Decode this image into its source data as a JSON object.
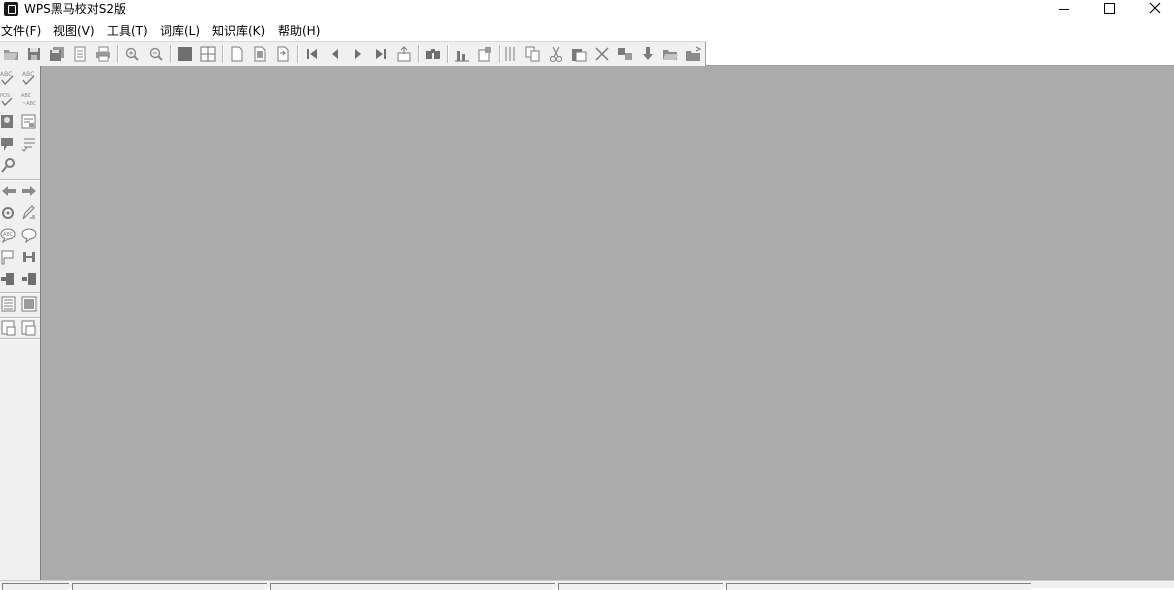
{
  "window": {
    "title": "WPS黑马校对S2版",
    "controls": [
      "minimize-icon",
      "maximize-icon",
      "close-icon"
    ]
  },
  "menu": {
    "items": [
      {
        "label": "文件(F)"
      },
      {
        "label": "视图(V)"
      },
      {
        "label": "工具(T)"
      },
      {
        "label": "词库(L)"
      },
      {
        "label": "知识库(K)"
      },
      {
        "label": "帮助(H)"
      }
    ]
  },
  "toolbar": {
    "buttons": [
      "open-folder-icon",
      "save-icon",
      "save-all-icon",
      "document-list-icon",
      "print-icon",
      "zoom-in-icon",
      "zoom-out-icon",
      "single-view-icon",
      "grid-view-icon",
      "page-icon",
      "page-duplicate-icon",
      "page-export-icon",
      "first-icon",
      "previous-icon",
      "next-icon",
      "last-icon",
      "jump-icon",
      "find-icon",
      "statistics-icon",
      "report-icon",
      "columns-icon",
      "copy-icon",
      "cut-icon",
      "paste-icon",
      "delete-icon",
      "replace-icon",
      "download-icon",
      "open-icon",
      "import-icon"
    ]
  },
  "left_toolbar": {
    "buttons": [
      "spell-check-icon",
      "abc-check-icon",
      "proofread-icon",
      "abc-compare-icon",
      "person-lookup-icon",
      "dictionary-icon",
      "comment-icon",
      "list-check-icon",
      "tool-icon",
      "back-arrow-icon",
      "forward-arrow-icon",
      "settings-icon",
      "pen-icon",
      "speech-bubble-icon",
      "speech-bubble-alt-icon",
      "flag-icon",
      "h-bar-icon",
      "plug-in-icon",
      "plug-out-icon",
      "page-list-icon",
      "image-icon",
      "export-left-icon",
      "export-right-icon"
    ]
  },
  "colors": {
    "workspace": "#ababab",
    "toolbar": "#f0f0f0"
  }
}
